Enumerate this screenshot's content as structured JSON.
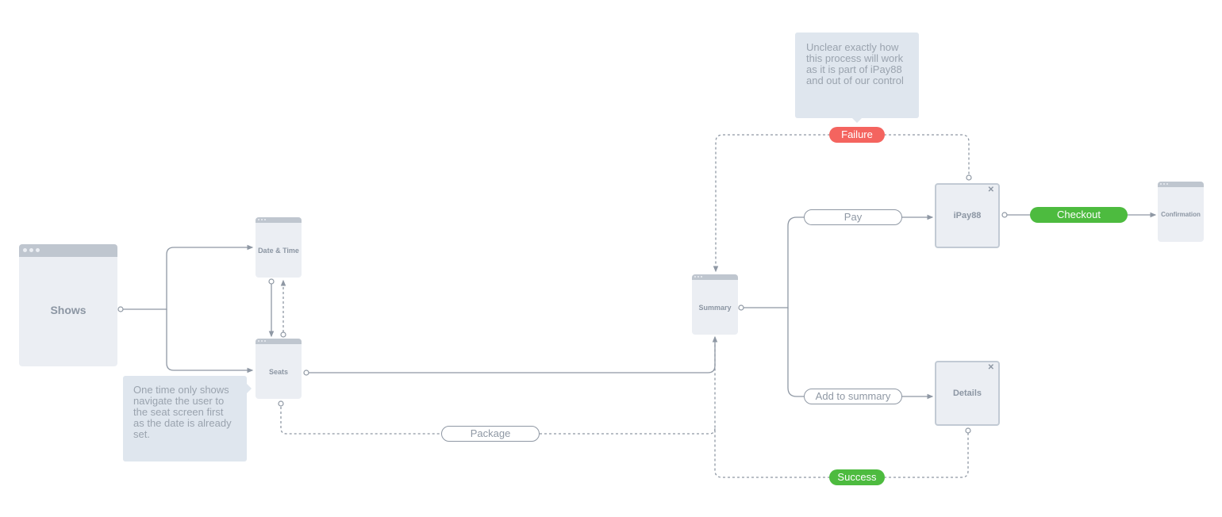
{
  "colors": {
    "line": "#8f98a4",
    "screen_fill": "#ebeef3",
    "screen_bar": "#bfc6cf",
    "note_fill": "#dfe6ee",
    "success": "#4dbb3f",
    "failure": "#f4645f"
  },
  "screens": {
    "shows": "Shows",
    "date_time": "Date & Time",
    "seats": "Seats",
    "summary": "Summary",
    "confirmation": "Confirmation"
  },
  "modals": {
    "ipay88": {
      "title": "iPay88",
      "close_icon": "close-icon"
    },
    "details": {
      "title": "Details",
      "close_icon": "close-icon"
    }
  },
  "pills": {
    "pay": "Pay",
    "add_to_summary": "Add to summary",
    "package": "Package",
    "checkout": "Checkout",
    "failure": "Failure",
    "success": "Success"
  },
  "notes": {
    "seats_note": "One time only shows navigate the user to the seat screen first as the date is already set.",
    "ipay_note": "Unclear exactly how this process will work as it is part of iPay88 and out of our control"
  }
}
